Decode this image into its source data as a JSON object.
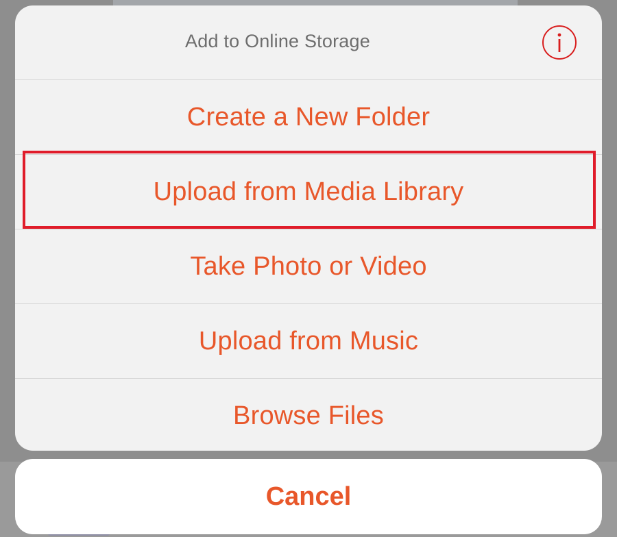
{
  "sheet": {
    "title": "Add to Online Storage",
    "info_icon": "info-icon",
    "actions": [
      {
        "label": "Create a New Folder"
      },
      {
        "label": "Upload from Media Library",
        "highlighted": true
      },
      {
        "label": "Take Photo or Video"
      },
      {
        "label": "Upload from Music"
      },
      {
        "label": "Browse Files"
      }
    ]
  },
  "cancel": {
    "label": "Cancel"
  },
  "colors": {
    "accent": "#e8572a",
    "info_icon": "#d81e1e",
    "highlight_border": "#e01c2a",
    "title_text": "#6d6d6d",
    "sheet_background": "#f2f2f2"
  }
}
